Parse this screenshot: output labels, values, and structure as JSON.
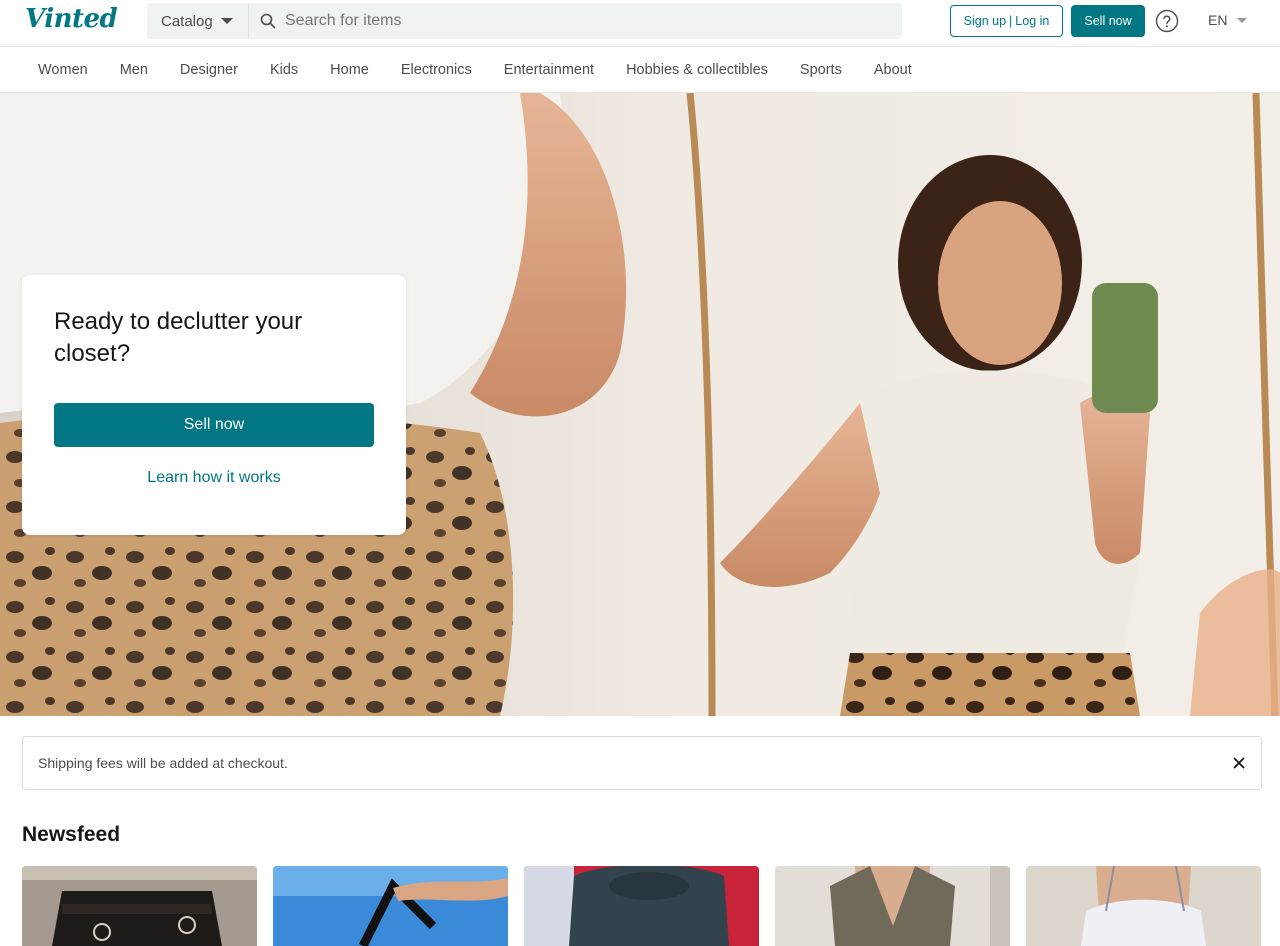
{
  "brand": {
    "logo_text": "Vinted",
    "accent_color": "#007782"
  },
  "header": {
    "catalog_label": "Catalog",
    "search_placeholder": "Search for items",
    "signup_label": "Sign up",
    "separator": "|",
    "login_label": "Log in",
    "sell_label": "Sell now",
    "help_icon": "question-circle-icon",
    "language": "EN"
  },
  "nav": {
    "items": [
      {
        "label": "Women"
      },
      {
        "label": "Men"
      },
      {
        "label": "Designer"
      },
      {
        "label": "Kids"
      },
      {
        "label": "Home"
      },
      {
        "label": "Electronics"
      },
      {
        "label": "Entertainment"
      },
      {
        "label": "Hobbies & collectibles"
      },
      {
        "label": "Sports"
      },
      {
        "label": "About"
      }
    ]
  },
  "hero": {
    "title": "Ready to declutter your closet?",
    "sell_button": "Sell now",
    "learn_link": "Learn how it works"
  },
  "banner": {
    "text": "Shipping fees will be added at checkout.",
    "close_icon": "close-icon"
  },
  "newsfeed": {
    "title": "Newsfeed",
    "items": [
      {
        "image": "designer-bag-photo"
      },
      {
        "image": "tote-bag-photo"
      },
      {
        "image": "velvet-top-photo"
      },
      {
        "image": "halter-vest-photo"
      },
      {
        "image": "lace-camisole-photo"
      }
    ]
  }
}
